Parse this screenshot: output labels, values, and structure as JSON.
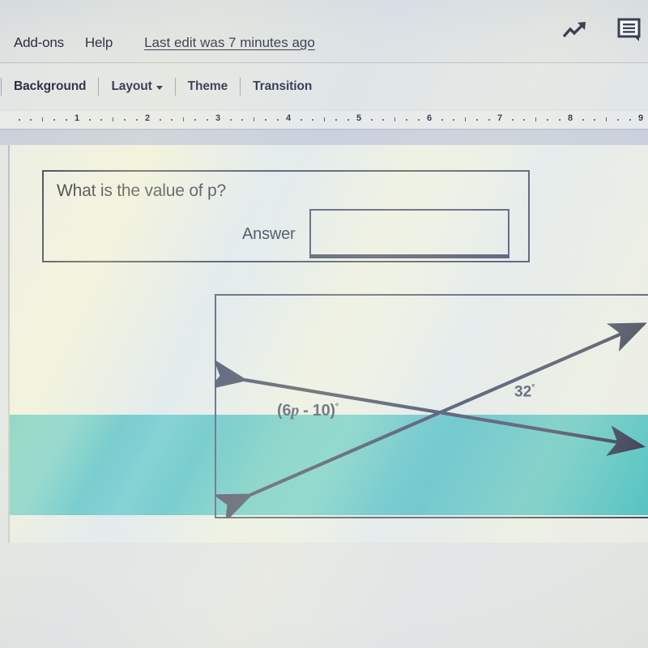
{
  "app": {
    "menus": [
      {
        "label": "Add-ons",
        "name": "menu-add-ons"
      },
      {
        "label": "Help",
        "name": "menu-help"
      }
    ],
    "last_edit": "Last edit was 7 minutes ago",
    "icons": [
      {
        "name": "explore-trending-icon",
        "glyph": "trending-up"
      },
      {
        "name": "comment-icon",
        "glyph": "speech-bubble-lines"
      }
    ]
  },
  "toolbar": {
    "buttons": [
      {
        "label": "Background",
        "name": "background-button",
        "has_caret": false
      },
      {
        "label": "Layout",
        "name": "layout-button",
        "has_caret": true
      },
      {
        "label": "Theme",
        "name": "theme-button",
        "has_caret": false
      },
      {
        "label": "Transition",
        "name": "transition-button",
        "has_caret": false
      }
    ]
  },
  "ruler": {
    "numbers": [
      "1",
      "2",
      "3",
      "4",
      "5",
      "6",
      "7",
      "8",
      "9"
    ]
  },
  "slide": {
    "background_color": "#eef0e8",
    "accent_color": "#4fc4c2",
    "question": {
      "prompt": "What is the value of p?",
      "answer_label": "Answer",
      "answer_value": "",
      "answer_placeholder": ""
    },
    "diagram": {
      "type": "intersecting-lines",
      "labels": {
        "left_angle_prefix": "(6",
        "left_angle_var": "p",
        "left_angle_suffix": " - 10)",
        "left_angle_degree": "°",
        "left_angle_full": "(6p - 10)°",
        "right_angle_value": "32",
        "right_angle_degree": "°",
        "right_angle_full": "32°"
      },
      "line_color": "#2a2f4a",
      "border_color": "#3b4057"
    }
  }
}
